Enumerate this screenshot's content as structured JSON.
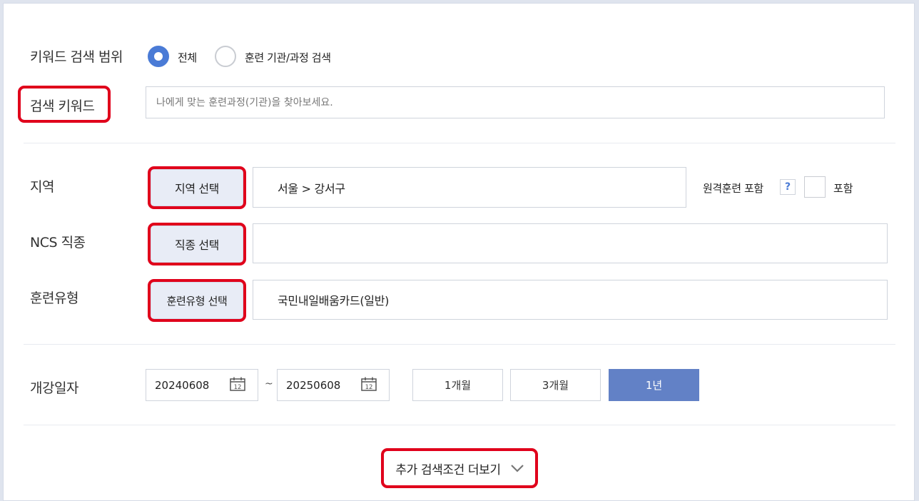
{
  "keyword_scope": {
    "label": "키워드 검색 범위",
    "options": [
      {
        "label": "전체",
        "selected": true
      },
      {
        "label": "훈련 기관/과정 검색",
        "selected": false
      }
    ]
  },
  "keyword": {
    "label": "검색 키워드",
    "placeholder": "나에게 맞는 훈련과정(기관)을 찾아보세요.",
    "value": ""
  },
  "region": {
    "label": "지역",
    "button": "지역 선택",
    "value": "서울 > 강서구",
    "remote_label": "원격훈련 포함",
    "help": "?",
    "checkbox_label": "포함",
    "checked": false
  },
  "ncs": {
    "label": "NCS 직종",
    "button": "직종 선택",
    "value": ""
  },
  "training_type": {
    "label": "훈련유형",
    "button": "훈련유형 선택",
    "value": "국민내일배움카드(일반)"
  },
  "start_date": {
    "label": "개강일자",
    "from": "20240608",
    "tilde": "~",
    "to": "20250608",
    "periods": [
      {
        "label": "1개월",
        "active": false
      },
      {
        "label": "3개월",
        "active": false
      },
      {
        "label": "1년",
        "active": true
      }
    ]
  },
  "more": {
    "label": "추가 검색조건 더보기"
  },
  "colors": {
    "accent": "#4a7bd6",
    "active_period": "#6281c6",
    "highlight": "#e0001b",
    "select_button_bg": "#e8ecf6"
  }
}
